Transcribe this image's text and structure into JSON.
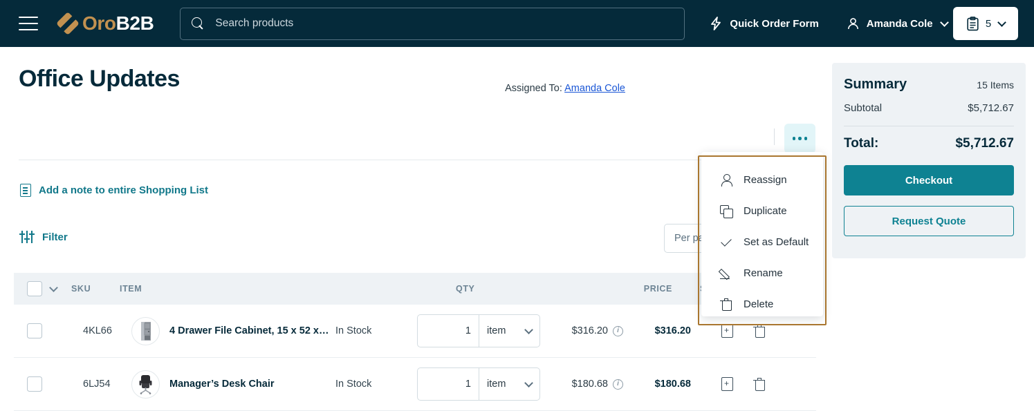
{
  "header": {
    "menu_icon": "hamburger-icon",
    "brand": {
      "part1": "Oro",
      "part2": "B2B"
    },
    "search": {
      "placeholder": "Search products",
      "value": "",
      "icon": "search-icon"
    },
    "quick_order_label": "Quick Order Form",
    "quick_order_icon": "lightning-icon",
    "user_name": "Amanda Cole",
    "user_icon": "person-icon",
    "cart": {
      "icon": "clipboard-list-icon",
      "count": "5"
    }
  },
  "page": {
    "title": "Office Updates",
    "assigned_label": "Assigned To:",
    "assigned_user": "Amanda Cole",
    "more_actions_icon": "ellipsis-icon",
    "note_link": "Add a note to entire Shopping List",
    "note_icon": "document-icon",
    "filter_label": "Filter",
    "filter_icon": "sliders-icon",
    "per_page_label": "Per page",
    "per_page_value": ""
  },
  "actions_menu": {
    "highlight_color": "#a9762f",
    "items": [
      {
        "label": "Reassign",
        "icon": "person-icon"
      },
      {
        "label": "Duplicate",
        "icon": "copy-icon"
      },
      {
        "label": "Set as Default",
        "icon": "check-icon"
      },
      {
        "label": "Rename",
        "icon": "pencil-icon"
      },
      {
        "label": "Delete",
        "icon": "trash-icon"
      }
    ]
  },
  "table": {
    "columns": [
      "SKU",
      "ITEM",
      "QTY",
      "PRICE",
      "SUBT"
    ],
    "select_all_icon": "checkbox-icon",
    "header_chevron_icon": "chevron-down-icon",
    "rows": [
      {
        "sku": "4KL66",
        "name": "4 Drawer File Cabinet, 15 x 52 x…",
        "thumb": "file-cabinet-thumbnail",
        "stock": "In Stock",
        "qty": "1",
        "unit": "item",
        "price": "$316.20",
        "subtotal": "$316.20",
        "action_note_icon": "add-note-icon",
        "action_delete_icon": "trash-icon"
      },
      {
        "sku": "6LJ54",
        "name": "Manager’s Desk Chair",
        "thumb": "desk-chair-thumbnail",
        "stock": "In Stock",
        "qty": "1",
        "unit": "item",
        "price": "$180.68",
        "subtotal": "$180.68",
        "action_note_icon": "add-note-icon",
        "action_delete_icon": "trash-icon"
      }
    ]
  },
  "summary": {
    "title": "Summary",
    "items_count": "15 Items",
    "subtotal_label": "Subtotal",
    "subtotal_value": "$5,712.67",
    "total_label": "Total:",
    "total_value": "$5,712.67",
    "checkout_label": "Checkout",
    "request_quote_label": "Request Quote",
    "accent_color": "#0e8292"
  }
}
